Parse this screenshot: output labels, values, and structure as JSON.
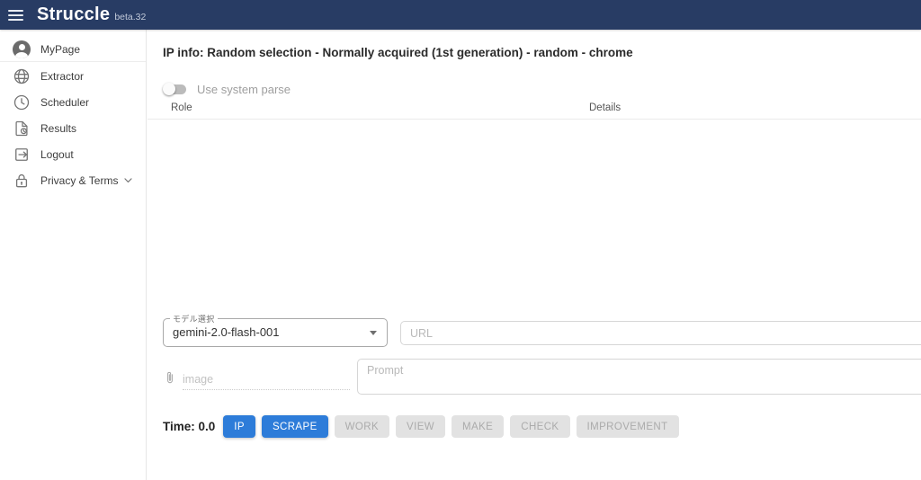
{
  "header": {
    "title": "Struccle",
    "version": "beta.32"
  },
  "sidebar": {
    "items": [
      {
        "label": "MyPage",
        "icon": "avatar-icon"
      },
      {
        "label": "Extractor",
        "icon": "globe-icon"
      },
      {
        "label": "Scheduler",
        "icon": "clock-icon"
      },
      {
        "label": "Results",
        "icon": "file-clock-icon"
      },
      {
        "label": "Logout",
        "icon": "logout-icon"
      },
      {
        "label": "Privacy & Terms",
        "icon": "lock-icon",
        "has_chevron": true
      }
    ]
  },
  "main": {
    "title": "IP info: Random selection - Normally acquired (1st generation) - random - chrome",
    "toggle": {
      "label": "Use system parse",
      "state": "off"
    },
    "table": {
      "columns": [
        "Role",
        "Details"
      ],
      "rows": []
    },
    "form": {
      "model": {
        "label": "モデル選択",
        "value": "gemini-2.0-flash-001"
      },
      "url": {
        "placeholder": "URL",
        "value": ""
      },
      "image": {
        "label": "image"
      },
      "prompt": {
        "placeholder": "Prompt",
        "value": ""
      }
    },
    "actions": {
      "time_label": "Time: 0.0",
      "buttons": [
        {
          "label": "IP",
          "enabled": true
        },
        {
          "label": "SCRAPE",
          "enabled": true
        },
        {
          "label": "WORK",
          "enabled": false
        },
        {
          "label": "VIEW",
          "enabled": false
        },
        {
          "label": "MAKE",
          "enabled": false
        },
        {
          "label": "CHECK",
          "enabled": false
        },
        {
          "label": "IMPROVEMENT",
          "enabled": false
        }
      ]
    }
  },
  "icons": {
    "menu": "hamburger-icon",
    "avatar": "avatar-icon",
    "globe": "globe-icon",
    "clock": "clock-icon",
    "file_clock": "file-clock-icon",
    "logout": "logout-icon",
    "lock": "lock-icon",
    "chevron": "chevron-down-icon",
    "paperclip": "paperclip-icon",
    "dropdown_arrow": "dropdown-arrow-icon"
  },
  "colors": {
    "header_bg": "#283c64",
    "accent_blue": "#2d7cd9",
    "disabled_bg": "#e2e2e2",
    "icon_gray": "#757575",
    "placeholder_gray": "#b9b9b9"
  }
}
